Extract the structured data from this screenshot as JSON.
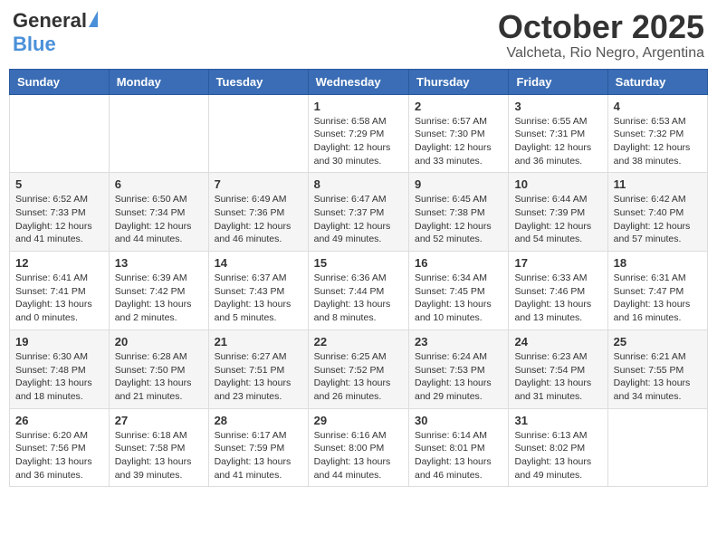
{
  "logo": {
    "general": "General",
    "blue": "Blue"
  },
  "title": "October 2025",
  "subtitle": "Valcheta, Rio Negro, Argentina",
  "days_of_week": [
    "Sunday",
    "Monday",
    "Tuesday",
    "Wednesday",
    "Thursday",
    "Friday",
    "Saturday"
  ],
  "weeks": [
    [
      {
        "day": "",
        "info": ""
      },
      {
        "day": "",
        "info": ""
      },
      {
        "day": "",
        "info": ""
      },
      {
        "day": "1",
        "info": "Sunrise: 6:58 AM\nSunset: 7:29 PM\nDaylight: 12 hours and 30 minutes."
      },
      {
        "day": "2",
        "info": "Sunrise: 6:57 AM\nSunset: 7:30 PM\nDaylight: 12 hours and 33 minutes."
      },
      {
        "day": "3",
        "info": "Sunrise: 6:55 AM\nSunset: 7:31 PM\nDaylight: 12 hours and 36 minutes."
      },
      {
        "day": "4",
        "info": "Sunrise: 6:53 AM\nSunset: 7:32 PM\nDaylight: 12 hours and 38 minutes."
      }
    ],
    [
      {
        "day": "5",
        "info": "Sunrise: 6:52 AM\nSunset: 7:33 PM\nDaylight: 12 hours and 41 minutes."
      },
      {
        "day": "6",
        "info": "Sunrise: 6:50 AM\nSunset: 7:34 PM\nDaylight: 12 hours and 44 minutes."
      },
      {
        "day": "7",
        "info": "Sunrise: 6:49 AM\nSunset: 7:36 PM\nDaylight: 12 hours and 46 minutes."
      },
      {
        "day": "8",
        "info": "Sunrise: 6:47 AM\nSunset: 7:37 PM\nDaylight: 12 hours and 49 minutes."
      },
      {
        "day": "9",
        "info": "Sunrise: 6:45 AM\nSunset: 7:38 PM\nDaylight: 12 hours and 52 minutes."
      },
      {
        "day": "10",
        "info": "Sunrise: 6:44 AM\nSunset: 7:39 PM\nDaylight: 12 hours and 54 minutes."
      },
      {
        "day": "11",
        "info": "Sunrise: 6:42 AM\nSunset: 7:40 PM\nDaylight: 12 hours and 57 minutes."
      }
    ],
    [
      {
        "day": "12",
        "info": "Sunrise: 6:41 AM\nSunset: 7:41 PM\nDaylight: 13 hours and 0 minutes."
      },
      {
        "day": "13",
        "info": "Sunrise: 6:39 AM\nSunset: 7:42 PM\nDaylight: 13 hours and 2 minutes."
      },
      {
        "day": "14",
        "info": "Sunrise: 6:37 AM\nSunset: 7:43 PM\nDaylight: 13 hours and 5 minutes."
      },
      {
        "day": "15",
        "info": "Sunrise: 6:36 AM\nSunset: 7:44 PM\nDaylight: 13 hours and 8 minutes."
      },
      {
        "day": "16",
        "info": "Sunrise: 6:34 AM\nSunset: 7:45 PM\nDaylight: 13 hours and 10 minutes."
      },
      {
        "day": "17",
        "info": "Sunrise: 6:33 AM\nSunset: 7:46 PM\nDaylight: 13 hours and 13 minutes."
      },
      {
        "day": "18",
        "info": "Sunrise: 6:31 AM\nSunset: 7:47 PM\nDaylight: 13 hours and 16 minutes."
      }
    ],
    [
      {
        "day": "19",
        "info": "Sunrise: 6:30 AM\nSunset: 7:48 PM\nDaylight: 13 hours and 18 minutes."
      },
      {
        "day": "20",
        "info": "Sunrise: 6:28 AM\nSunset: 7:50 PM\nDaylight: 13 hours and 21 minutes."
      },
      {
        "day": "21",
        "info": "Sunrise: 6:27 AM\nSunset: 7:51 PM\nDaylight: 13 hours and 23 minutes."
      },
      {
        "day": "22",
        "info": "Sunrise: 6:25 AM\nSunset: 7:52 PM\nDaylight: 13 hours and 26 minutes."
      },
      {
        "day": "23",
        "info": "Sunrise: 6:24 AM\nSunset: 7:53 PM\nDaylight: 13 hours and 29 minutes."
      },
      {
        "day": "24",
        "info": "Sunrise: 6:23 AM\nSunset: 7:54 PM\nDaylight: 13 hours and 31 minutes."
      },
      {
        "day": "25",
        "info": "Sunrise: 6:21 AM\nSunset: 7:55 PM\nDaylight: 13 hours and 34 minutes."
      }
    ],
    [
      {
        "day": "26",
        "info": "Sunrise: 6:20 AM\nSunset: 7:56 PM\nDaylight: 13 hours and 36 minutes."
      },
      {
        "day": "27",
        "info": "Sunrise: 6:18 AM\nSunset: 7:58 PM\nDaylight: 13 hours and 39 minutes."
      },
      {
        "day": "28",
        "info": "Sunrise: 6:17 AM\nSunset: 7:59 PM\nDaylight: 13 hours and 41 minutes."
      },
      {
        "day": "29",
        "info": "Sunrise: 6:16 AM\nSunset: 8:00 PM\nDaylight: 13 hours and 44 minutes."
      },
      {
        "day": "30",
        "info": "Sunrise: 6:14 AM\nSunset: 8:01 PM\nDaylight: 13 hours and 46 minutes."
      },
      {
        "day": "31",
        "info": "Sunrise: 6:13 AM\nSunset: 8:02 PM\nDaylight: 13 hours and 49 minutes."
      },
      {
        "day": "",
        "info": ""
      }
    ]
  ]
}
